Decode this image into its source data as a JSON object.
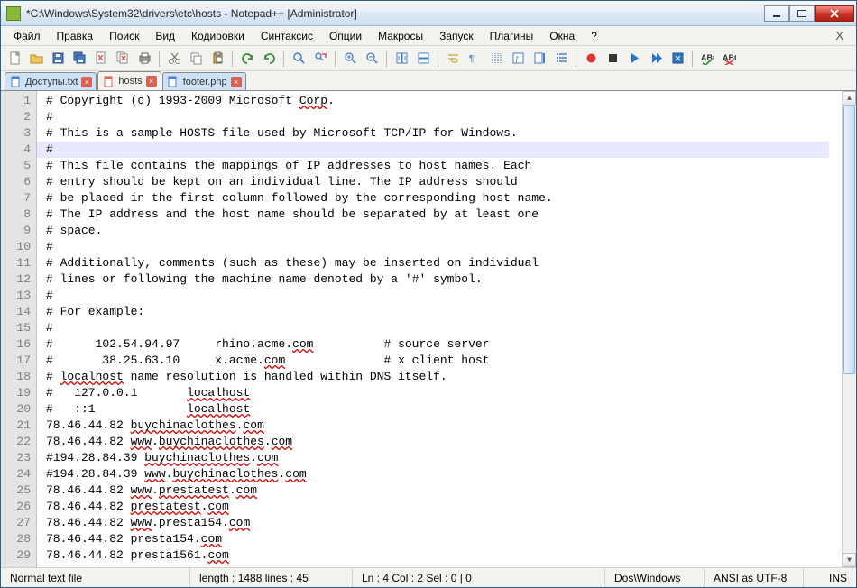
{
  "window": {
    "title": "*C:\\Windows\\System32\\drivers\\etc\\hosts - Notepad++ [Administrator]"
  },
  "menu": {
    "items": [
      "Файл",
      "Правка",
      "Поиск",
      "Вид",
      "Кодировки",
      "Синтаксис",
      "Опции",
      "Макросы",
      "Запуск",
      "Плагины",
      "Окна",
      "?"
    ]
  },
  "toolbar_icons": [
    "new-file-icon",
    "open-file-icon",
    "save-icon",
    "save-all-icon",
    "close-icon",
    "close-all-icon",
    "print-icon",
    "sep",
    "cut-icon",
    "copy-icon",
    "paste-icon",
    "sep",
    "undo-icon",
    "redo-icon",
    "sep",
    "find-icon",
    "replace-icon",
    "sep",
    "zoom-in-icon",
    "zoom-out-icon",
    "sep",
    "sync-v-icon",
    "sync-h-icon",
    "sep",
    "wrap-icon",
    "show-all-icon",
    "indent-guide-icon",
    "lang-icon",
    "doc-map-icon",
    "func-list-icon",
    "sep",
    "record-macro-icon",
    "stop-macro-icon",
    "play-macro-icon",
    "play-multi-icon",
    "save-macro-icon",
    "sep",
    "spell-check-on-icon",
    "spell-check-off-icon"
  ],
  "tabs": [
    {
      "label": "Доступы.txt",
      "icon": "file-blue-icon",
      "active": false
    },
    {
      "label": "hosts",
      "icon": "file-red-icon",
      "active": true
    },
    {
      "label": "footer.php",
      "icon": "file-blue-icon",
      "active": false
    }
  ],
  "editor": {
    "highlight_line": 4,
    "lines": [
      {
        "n": 1,
        "segs": [
          {
            "t": "# Copyright (c) 1993-2009 Microsoft "
          },
          {
            "t": "Corp",
            "sq": true
          },
          {
            "t": "."
          }
        ]
      },
      {
        "n": 2,
        "segs": [
          {
            "t": "#"
          }
        ]
      },
      {
        "n": 3,
        "segs": [
          {
            "t": "# This is a sample HOSTS file used by Microsoft TCP/IP for Windows."
          }
        ]
      },
      {
        "n": 4,
        "segs": [
          {
            "t": "#"
          }
        ]
      },
      {
        "n": 5,
        "segs": [
          {
            "t": "# This file contains the mappings of IP addresses to host names. Each"
          }
        ]
      },
      {
        "n": 6,
        "segs": [
          {
            "t": "# entry should be kept on an individual line. The IP address should"
          }
        ]
      },
      {
        "n": 7,
        "segs": [
          {
            "t": "# be placed in the first column followed by the corresponding host name."
          }
        ]
      },
      {
        "n": 8,
        "segs": [
          {
            "t": "# The IP address and the host name should be separated by at least one"
          }
        ]
      },
      {
        "n": 9,
        "segs": [
          {
            "t": "# space."
          }
        ]
      },
      {
        "n": 10,
        "segs": [
          {
            "t": "#"
          }
        ]
      },
      {
        "n": 11,
        "segs": [
          {
            "t": "# Additionally, comments (such as these) may be inserted on individual"
          }
        ]
      },
      {
        "n": 12,
        "segs": [
          {
            "t": "# lines or following the machine name denoted by a '#' symbol."
          }
        ]
      },
      {
        "n": 13,
        "segs": [
          {
            "t": "#"
          }
        ]
      },
      {
        "n": 14,
        "segs": [
          {
            "t": "# For example:"
          }
        ]
      },
      {
        "n": 15,
        "segs": [
          {
            "t": "#"
          }
        ]
      },
      {
        "n": 16,
        "segs": [
          {
            "t": "#      102.54.94.97     rhino.acme."
          },
          {
            "t": "com",
            "sq": true
          },
          {
            "t": "          # source server"
          }
        ]
      },
      {
        "n": 17,
        "segs": [
          {
            "t": "#       38.25.63.10     x.acme."
          },
          {
            "t": "com",
            "sq": true
          },
          {
            "t": "              # x client host"
          }
        ]
      },
      {
        "n": 18,
        "segs": [
          {
            "t": "# "
          },
          {
            "t": "localhost",
            "sq": true
          },
          {
            "t": " name resolution is handled within DNS itself."
          }
        ]
      },
      {
        "n": 19,
        "segs": [
          {
            "t": "#   127.0.0.1       "
          },
          {
            "t": "localhost",
            "sq": true
          }
        ]
      },
      {
        "n": 20,
        "segs": [
          {
            "t": "#   ::1             "
          },
          {
            "t": "localhost",
            "sq": true
          }
        ]
      },
      {
        "n": 21,
        "segs": [
          {
            "t": "78.46.44.82 "
          },
          {
            "t": "buychinaclothes",
            "sq": true
          },
          {
            "t": "."
          },
          {
            "t": "com",
            "sq": true
          }
        ]
      },
      {
        "n": 22,
        "segs": [
          {
            "t": "78.46.44.82 "
          },
          {
            "t": "www",
            "sq": true
          },
          {
            "t": "."
          },
          {
            "t": "buychinaclothes",
            "sq": true
          },
          {
            "t": "."
          },
          {
            "t": "com",
            "sq": true
          }
        ]
      },
      {
        "n": 23,
        "segs": [
          {
            "t": "#194.28.84.39 "
          },
          {
            "t": "buychinaclothes",
            "sq": true
          },
          {
            "t": "."
          },
          {
            "t": "com",
            "sq": true
          }
        ]
      },
      {
        "n": 24,
        "segs": [
          {
            "t": "#194.28.84.39 "
          },
          {
            "t": "www",
            "sq": true
          },
          {
            "t": "."
          },
          {
            "t": "buychinaclothes",
            "sq": true
          },
          {
            "t": "."
          },
          {
            "t": "com",
            "sq": true
          }
        ]
      },
      {
        "n": 25,
        "segs": [
          {
            "t": "78.46.44.82 "
          },
          {
            "t": "www",
            "sq": true
          },
          {
            "t": "."
          },
          {
            "t": "prestatest",
            "sq": true
          },
          {
            "t": "."
          },
          {
            "t": "com",
            "sq": true
          }
        ]
      },
      {
        "n": 26,
        "segs": [
          {
            "t": "78.46.44.82 "
          },
          {
            "t": "prestatest",
            "sq": true
          },
          {
            "t": "."
          },
          {
            "t": "com",
            "sq": true
          }
        ]
      },
      {
        "n": 27,
        "segs": [
          {
            "t": "78.46.44.82 "
          },
          {
            "t": "www",
            "sq": true
          },
          {
            "t": ".presta154."
          },
          {
            "t": "com",
            "sq": true
          }
        ]
      },
      {
        "n": 28,
        "segs": [
          {
            "t": "78.46.44.82 presta154."
          },
          {
            "t": "com",
            "sq": true
          }
        ]
      },
      {
        "n": 29,
        "segs": [
          {
            "t": "78.46.44.82 presta1561."
          },
          {
            "t": "com",
            "sq": true
          }
        ]
      }
    ]
  },
  "status": {
    "doctype": "Normal text file",
    "length_label": "length : 1488    lines : 45",
    "pos_label": "Ln : 4    Col : 2    Sel : 0 | 0",
    "eol": "Dos\\Windows",
    "encoding": "ANSI as UTF-8",
    "ins": "INS"
  },
  "icon_colors": {
    "new-file-icon": "#fff",
    "open-file-icon": "#f7c55d",
    "save-icon": "#4a7cc5",
    "save-all-icon": "#4a7cc5",
    "close-icon": "#d86155",
    "close-all-icon": "#d86155",
    "print-icon": "#999",
    "cut-icon": "#888",
    "copy-icon": "#888",
    "paste-icon": "#caa45a",
    "undo-icon": "#3b8e3b",
    "redo-icon": "#3b8e3b",
    "find-icon": "#4a7cc5",
    "replace-icon": "#4a7cc5",
    "zoom-in-icon": "#4a7cc5",
    "zoom-out-icon": "#4a7cc5",
    "sync-v-icon": "#4a7cc5",
    "sync-h-icon": "#4a7cc5",
    "wrap-icon": "#c7a52f",
    "show-all-icon": "#4a7cc5",
    "indent-guide-icon": "#4a7cc5",
    "lang-icon": "#4a7cc5",
    "doc-map-icon": "#4a7cc5",
    "func-list-icon": "#4a7cc5",
    "record-macro-icon": "#d33",
    "stop-macro-icon": "#333",
    "play-macro-icon": "#2b74c9",
    "play-multi-icon": "#2b74c9",
    "save-macro-icon": "#2b74c9",
    "spell-check-on-icon": "#c7a52f",
    "spell-check-off-icon": "#c7a52f"
  }
}
